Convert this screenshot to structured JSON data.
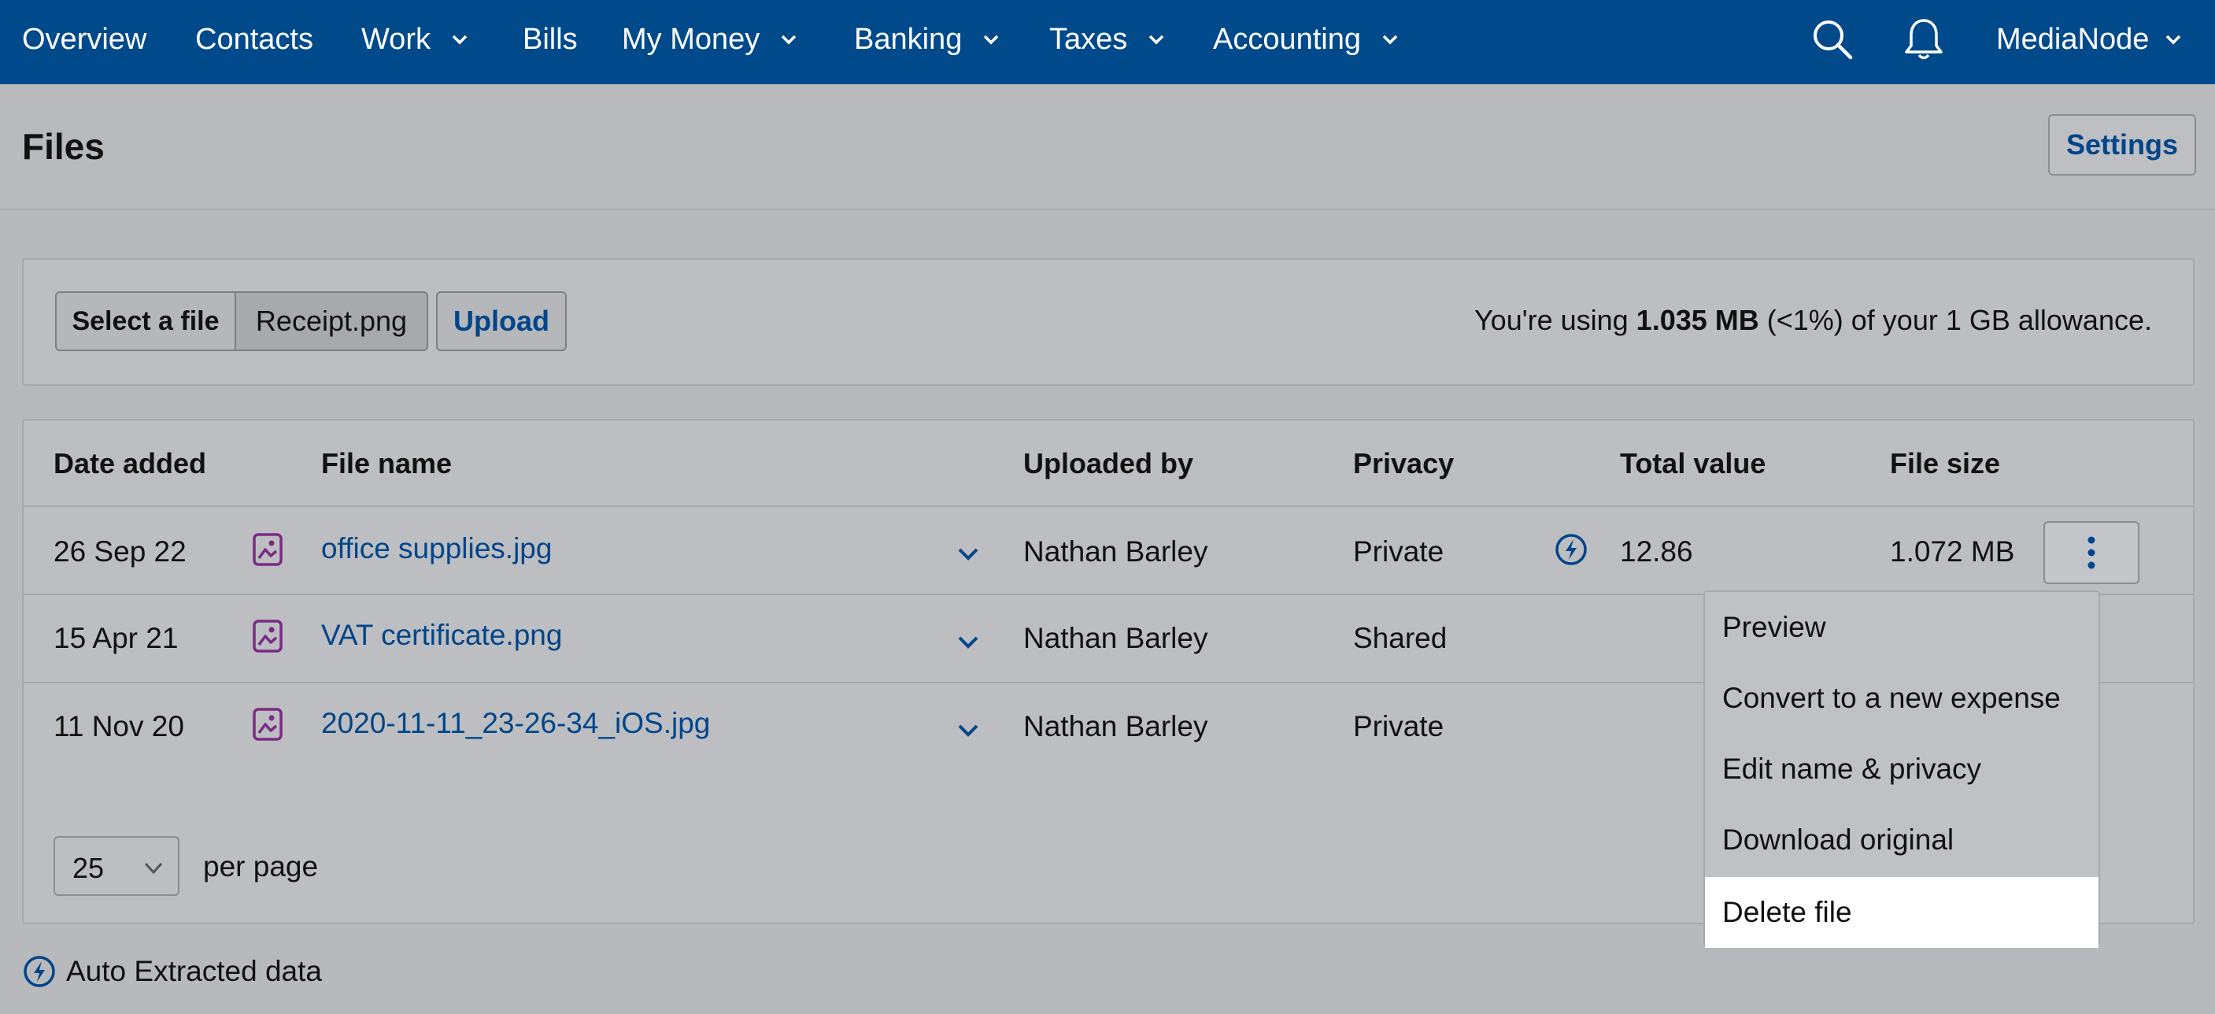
{
  "nav": {
    "items": [
      {
        "label": "Overview",
        "has_menu": false
      },
      {
        "label": "Contacts",
        "has_menu": false
      },
      {
        "label": "Work",
        "has_menu": true
      },
      {
        "label": "Bills",
        "has_menu": false
      },
      {
        "label": "My Money",
        "has_menu": true
      },
      {
        "label": "Banking",
        "has_menu": true
      },
      {
        "label": "Taxes",
        "has_menu": true
      },
      {
        "label": "Accounting",
        "has_menu": true
      }
    ],
    "search_icon": "search-icon",
    "notifications_icon": "bell-icon",
    "account": "MediaNode"
  },
  "page": {
    "title": "Files",
    "settings_label": "Settings"
  },
  "upload": {
    "select_label": "Select a file",
    "chosen_file": "Receipt.png",
    "upload_label": "Upload",
    "usage_prefix": "You're using ",
    "usage_amount": "1.035 MB",
    "usage_suffix": " (<1%) of your 1 GB allowance."
  },
  "table": {
    "headers": {
      "date": "Date added",
      "name": "File name",
      "uploaded_by": "Uploaded by",
      "privacy": "Privacy",
      "total": "Total value",
      "size": "File size"
    },
    "rows": [
      {
        "date": "26 Sep 22",
        "name": "office supplies.jpg",
        "uploaded_by": "Nathan Barley",
        "privacy": "Private",
        "auto_extracted": true,
        "total": "12.86",
        "size": "1.072 MB"
      },
      {
        "date": "15 Apr 21",
        "name": "VAT certificate.png",
        "uploaded_by": "Nathan Barley",
        "privacy": "Shared",
        "auto_extracted": false,
        "total": "",
        "size": ""
      },
      {
        "date": "11 Nov 20",
        "name": "2020-11-11_23-26-34_iOS.jpg",
        "uploaded_by": "Nathan Barley",
        "privacy": "Private",
        "auto_extracted": false,
        "total": "",
        "size": ""
      }
    ],
    "per_page_value": "25",
    "per_page_label": "per page"
  },
  "menu": {
    "items": [
      "Preview",
      "Convert to a new expense",
      "Edit name & privacy",
      "Download original",
      "Delete file"
    ],
    "highlighted": "Delete file"
  },
  "footer": {
    "note": "Auto Extracted data"
  },
  "colors": {
    "nav_bg": "#004a8b",
    "link": "#00458a",
    "file_icon": "#7b2a84"
  }
}
